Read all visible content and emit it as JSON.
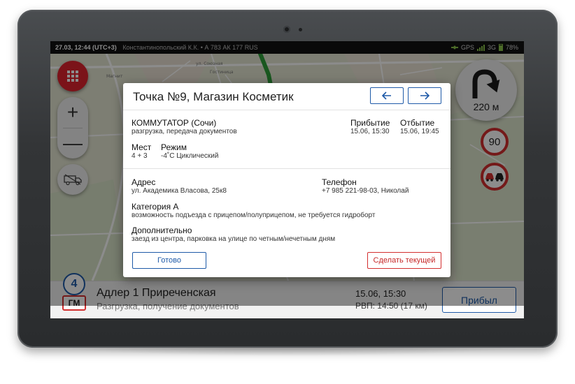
{
  "status_bar": {
    "time": "27.03, 12:44 (UTC+3)",
    "driver": "Константинопольский К.К. • А 783 АК 177 RUS",
    "gps": "GPS",
    "network": "3G",
    "battery": "78%"
  },
  "map_controls": {
    "zoom_in": "+",
    "zoom_out": "—",
    "maneuver_distance": "220 м",
    "speed_limit": "90"
  },
  "bottom_bar": {
    "point_number": "4",
    "point_type": "ГМ",
    "destination_name": "Адлер 1 Приреченская",
    "destination_sub": "Разгрузка, получение документов",
    "time": "15.06, 15:30",
    "rvp": "РВП: 14:50 (17 км)",
    "arrived_label": "Прибыл"
  },
  "dialog": {
    "title": "Точка №9, Магазин Косметик",
    "client": "КОММУТАТОР (Сочи)",
    "operations": "разгрузка, передача документов",
    "arrival_label": "Прибытие",
    "arrival_value": "15.06, 15:30",
    "departure_label": "Отбытие",
    "departure_value": "15.06, 19:45",
    "places_label": "Мест",
    "places_value": "4 + 3",
    "mode_label": "Режим",
    "mode_value": "-4˚С Циклический",
    "address_label": "Адрес",
    "address_value": "ул. Академика Власова, 25к8",
    "phone_label": "Телефон",
    "phone_value": "+7 985 221-98-03, Николай",
    "category_label": "Категория А",
    "category_value": "возможность подъезда с прицепом/полуприцепом,  не требуется гидроборт",
    "extra_label": "Дополнительно",
    "extra_value": "заезд из центра, парковка на улице по четным/нечетным дням",
    "done_label": "Готово",
    "make_current_label": "Сделать текущей"
  },
  "colors": {
    "accent_blue": "#1e5aa8",
    "accent_red": "#d32f2f",
    "map_bg": "#e9e4d6",
    "route_green": "#2e9e3a"
  }
}
